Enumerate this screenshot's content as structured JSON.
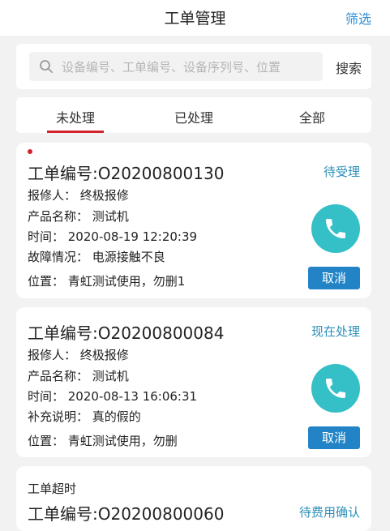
{
  "header": {
    "title": "工单管理",
    "filter_label": "筛选"
  },
  "search": {
    "placeholder": "设备编号、工单编号、设备序列号、位置",
    "button_label": "搜索"
  },
  "tabs": [
    {
      "label": "未处理",
      "active": true
    },
    {
      "label": "已处理",
      "active": false
    },
    {
      "label": "全部",
      "active": false
    }
  ],
  "colors": {
    "accent": "#d3232a",
    "button": "#2284c6",
    "phone": "#34c0c6",
    "status": "#2b8fb8"
  },
  "orders": [
    {
      "code": "工单编号:O20200800130",
      "status": "待受理",
      "reporter": "报修人：  终极报修",
      "product": "产品名称：  测试机",
      "time": "时间：  2020-08-19 12:20:39",
      "extra": "故障情况：  电源接触不良",
      "location": "位置：  青虹测试使用，勿删1",
      "cancel_label": "取消"
    },
    {
      "code": "工单编号:O20200800084",
      "status": "现在处理",
      "reporter": "报修人：  终极报修",
      "product": "产品名称：  测试机",
      "time": "时间：  2020-08-13 16:06:31",
      "extra": "补充说明：  真的假的",
      "location": "位置：  青虹测试使用，勿删",
      "cancel_label": "取消"
    },
    {
      "timeout_label": "工单超时",
      "code": "工单编号:O20200800060",
      "status": "待费用确认"
    }
  ]
}
